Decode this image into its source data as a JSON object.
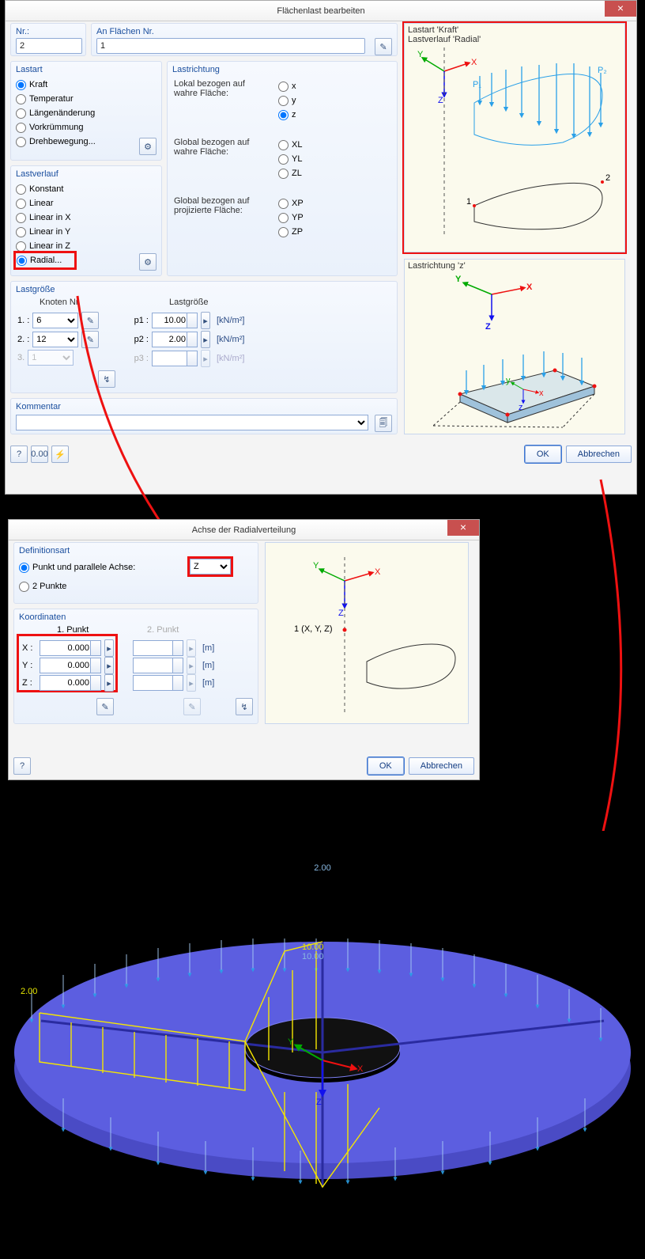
{
  "dlg1": {
    "title": "Flächenlast bearbeiten",
    "nr_lbl": "Nr.:",
    "nr_val": "2",
    "anfl_lbl": "An Flächen Nr.",
    "anfl_val": "1",
    "lastart_ttl": "Lastart",
    "lastart_opts": [
      "Kraft",
      "Temperatur",
      "Längenänderung",
      "Vorkrümmung",
      "Drehbewegung..."
    ],
    "lastverlauf_ttl": "Lastverlauf",
    "lastverlauf_opts": [
      "Konstant",
      "Linear",
      "Linear in X",
      "Linear in Y",
      "Linear in Z",
      "Radial..."
    ],
    "lastrichtung_ttl": "Lastrichtung",
    "lokal_lbl": "Lokal bezogen auf wahre Fläche:",
    "lokal_opts": [
      "x",
      "y",
      "z"
    ],
    "global1_lbl": "Global bezogen auf wahre Fläche:",
    "global1_opts": [
      "XL",
      "YL",
      "ZL"
    ],
    "global2_lbl": "Global bezogen auf projizierte Fläche:",
    "global2_opts": [
      "XP",
      "YP",
      "ZP"
    ],
    "lastgroesse_ttl": "Lastgröße",
    "knoten_lbl": "Knoten Nr.",
    "lastgroesse_col": "Lastgröße",
    "rows": [
      {
        "idx": "1. :",
        "knoten": "6",
        "p_lbl": "p1 :",
        "p_val": "10.00",
        "unit": "[kN/m²]"
      },
      {
        "idx": "2. :",
        "knoten": "12",
        "p_lbl": "p2 :",
        "p_val": "2.00",
        "unit": "[kN/m²]"
      },
      {
        "idx": "3. ",
        "knoten": "1",
        "p_lbl": "p3 :",
        "p_val": "",
        "unit": "[kN/m²]"
      }
    ],
    "kommentar_ttl": "Kommentar",
    "ok": "OK",
    "cancel": "Abbrechen",
    "prev1_l1": "Lastart 'Kraft'",
    "prev1_l2": "Lastverlauf 'Radial'",
    "prev2_l1": "Lastrichtung 'z'"
  },
  "dlg2": {
    "title": "Achse der Radialverteilung",
    "def_ttl": "Definitionsart",
    "opt1": "Punkt und parallele Achse:",
    "axis_sel": "Z",
    "opt2": "2 Punkte",
    "koord_ttl": "Koordinaten",
    "col1": "1. Punkt",
    "col2": "2. Punkt",
    "rows": [
      {
        "lbl": "X :",
        "v1": "0.000",
        "unit": "[m]"
      },
      {
        "lbl": "Y :",
        "v1": "0.000",
        "unit": "[m]"
      },
      {
        "lbl": "Z :",
        "v1": "0.000",
        "unit": "[m]"
      }
    ],
    "ok": "OK",
    "cancel": "Abbrechen",
    "prev_pt": "1 (X, Y, Z)"
  },
  "render": {
    "labels": [
      "2.00",
      "2.00",
      "10.00",
      "10.00"
    ]
  }
}
